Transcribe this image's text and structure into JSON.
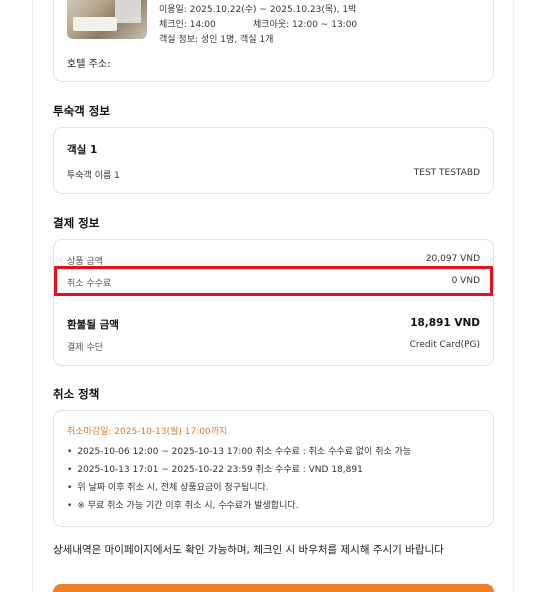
{
  "hotel_card": {
    "stay_dates": "이용일: 2025.10.22(수) ~ 2025.10.23(목), 1박",
    "checkin": "체크인: 14:00",
    "checkout": "체크아웃: 12:00 ~ 13:00",
    "room_info": "객실 정보: 성인 1명, 객실 1개",
    "address_label": "호텔 주소:"
  },
  "guest_section": {
    "title": "투숙객 정보",
    "room_label": "객실 1",
    "guest_name_label": "투숙객 이름 1",
    "guest_name_value": "TEST TESTABD"
  },
  "payment_section": {
    "title": "결제 정보",
    "product_amount_label": "상품 금액",
    "product_amount_value": "20,097 VND",
    "cancel_fee_label": "취소 수수료",
    "cancel_fee_value": "0 VND",
    "refund_label": "환불될 금액",
    "refund_value": "18,891 VND",
    "method_label": "결제 수단",
    "method_value": "Credit Card(PG)"
  },
  "policy_section": {
    "title": "취소 정책",
    "deadline": "취소마감일: 2025-10-13(월) 17:00까지",
    "items": [
      "2025-10-06 12:00 ~ 2025-10-13 17:00 취소 수수료 : 취소 수수료 없이 취소 가능",
      "2025-10-13 17:01 ~ 2025-10-22 23:59 취소 수수료 : VND 18,891",
      "위 날짜 이후 취소 시, 전체 상품요금이 청구됩니다.",
      "※ 무료 취소 가능 기간 이후 취소 시, 수수료가 발생합니다."
    ]
  },
  "footer_note": "상세내역은 마이페이지에서도 확인 가능하며, 체크인 시 바우처를 제시해 주시기 바랍니다",
  "colors": {
    "accent_orange": "#f07f26",
    "deadline_orange": "#e07a2d",
    "highlight_red": "#e0131c"
  }
}
